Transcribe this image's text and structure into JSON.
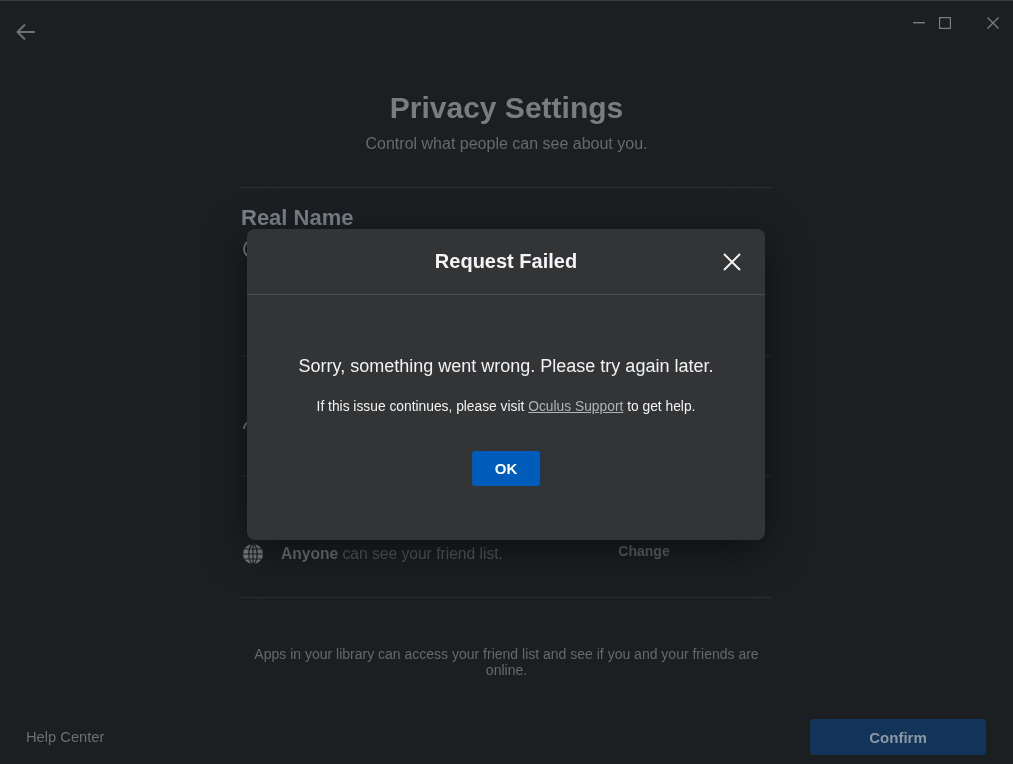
{
  "page": {
    "title": "Privacy Settings",
    "subtitle": "Control what people can see about you."
  },
  "sections": [
    {
      "kind": "name",
      "heading": "Real Name"
    },
    {
      "kind": "account"
    },
    {
      "kind": "visibility",
      "description": "**Anyone** can see your friend list.",
      "action": "Change"
    }
  ],
  "footnote": "Apps in your library can access your friend list and see if you and your friends are online.",
  "footer": {
    "help_link": "Help Center",
    "confirm_button": "Confirm"
  },
  "dialog": {
    "title": "Request Failed",
    "message": "Sorry, something went wrong. Please try again later.",
    "detail_before": "If this issue continues, please visit",
    "link": "Oculus Support",
    "detail_after": "to get help.",
    "button": "OK"
  }
}
